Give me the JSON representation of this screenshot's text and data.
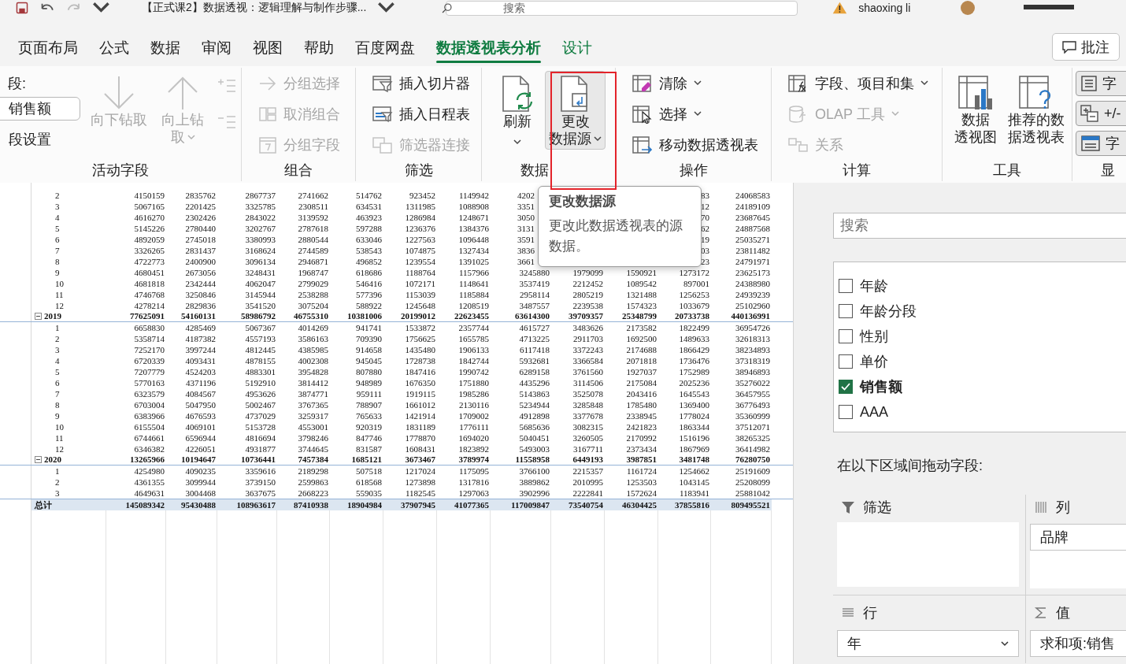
{
  "title_bar": {
    "document_title": "【正式课2】数据透视：逻辑理解与制作步骤...",
    "search_placeholder": "搜索",
    "user_name": "shaoxing li"
  },
  "ribbon_tabs": [
    {
      "label": "页面布局",
      "selected": false,
      "contextual": false
    },
    {
      "label": "公式",
      "selected": false,
      "contextual": false
    },
    {
      "label": "数据",
      "selected": false,
      "contextual": false
    },
    {
      "label": "审阅",
      "selected": false,
      "contextual": false
    },
    {
      "label": "视图",
      "selected": false,
      "contextual": false
    },
    {
      "label": "帮助",
      "selected": false,
      "contextual": false
    },
    {
      "label": "百度网盘",
      "selected": false,
      "contextual": false
    },
    {
      "label": "数据透视表分析",
      "selected": true,
      "contextual": true
    },
    {
      "label": "设计",
      "selected": false,
      "contextual": true
    }
  ],
  "comment_button": "批注",
  "ribbon_groups": [
    {
      "label": "活动字段",
      "columns": [
        [
          {
            "kind": "label",
            "text": "段:"
          },
          {
            "kind": "field",
            "value": "销售额"
          },
          {
            "kind": "text",
            "text": "段设置"
          }
        ],
        [
          {
            "kind": "large",
            "lines": [
              "向下钻取"
            ],
            "disabled": true,
            "hovered": false
          }
        ],
        [
          {
            "kind": "large",
            "lines": [
              "向上钻",
              "取"
            ],
            "disabled": true,
            "hovered": false,
            "dropdown": true
          }
        ],
        [
          {
            "kind": "icon",
            "disabled": true,
            "hovered": false
          },
          {
            "kind": "icon",
            "disabled": true,
            "hovered": false
          }
        ]
      ]
    },
    {
      "label": "组合",
      "columns": [
        [
          {
            "kind": "small",
            "text": "分组选择",
            "disabled": true,
            "hovered": false
          },
          {
            "kind": "small",
            "text": "取消组合",
            "disabled": true,
            "hovered": false
          },
          {
            "kind": "small",
            "text": "分组字段",
            "disabled": true,
            "hovered": false
          }
        ]
      ]
    },
    {
      "label": "筛选",
      "columns": [
        [
          {
            "kind": "small",
            "text": "插入切片器",
            "disabled": false,
            "hovered": false
          },
          {
            "kind": "small",
            "text": "插入日程表",
            "disabled": false,
            "hovered": false
          },
          {
            "kind": "small",
            "text": "筛选器连接",
            "disabled": true,
            "hovered": false
          }
        ]
      ]
    },
    {
      "label": "数据",
      "columns": [
        [
          {
            "kind": "large",
            "lines": [
              "刷新"
            ],
            "disabled": false,
            "hovered": false,
            "dropdown": true
          }
        ],
        [
          {
            "kind": "large",
            "lines": [
              "更改",
              "数据源"
            ],
            "disabled": false,
            "hovered": true,
            "dropdown": true
          }
        ]
      ]
    },
    {
      "label": "操作",
      "columns": [
        [
          {
            "kind": "small",
            "text": "清除",
            "disabled": false,
            "hovered": false,
            "dropdown": true
          },
          {
            "kind": "small",
            "text": "选择",
            "disabled": false,
            "hovered": false,
            "dropdown": true
          },
          {
            "kind": "small",
            "text": "移动数据透视表",
            "disabled": false,
            "hovered": false
          }
        ]
      ]
    },
    {
      "label": "计算",
      "columns": [
        [
          {
            "kind": "small",
            "text": "字段、项目和集",
            "disabled": false,
            "hovered": false,
            "dropdown": true
          },
          {
            "kind": "small",
            "text": "OLAP 工具",
            "disabled": true,
            "hovered": false,
            "dropdown": true
          },
          {
            "kind": "small",
            "text": "关系",
            "disabled": true,
            "hovered": false
          }
        ]
      ]
    },
    {
      "label": "工具",
      "columns": [
        [
          {
            "kind": "large",
            "lines": [
              "数据",
              "透视图"
            ],
            "disabled": false,
            "hovered": false
          }
        ],
        [
          {
            "kind": "large",
            "lines": [
              "推荐的数",
              "据透视表"
            ],
            "disabled": false,
            "hovered": false
          }
        ]
      ]
    },
    {
      "label": "显",
      "columns": [
        [
          {
            "kind": "toggle",
            "text": "字",
            "on": true
          },
          {
            "kind": "toggle",
            "text": "+/-",
            "on": true
          },
          {
            "kind": "toggle",
            "text": "字",
            "on": true
          }
        ]
      ]
    }
  ],
  "tooltip": {
    "title": "更改数据源",
    "text": "更改此数据透视表的源数据。"
  },
  "pivot_table": {
    "rows": [
      {
        "kind": "month",
        "label": "2",
        "cells": [
          "4150159",
          "2835762",
          "2867737",
          "2741662",
          "514762",
          "923452",
          "1149942",
          {
            "text": "4202",
            "cut": true
          },
          null,
          null,
          "83",
          "24068583"
        ]
      },
      {
        "kind": "month",
        "label": "3",
        "cells": [
          "5067165",
          "2201425",
          "3325785",
          "2308511",
          "634531",
          "1311985",
          "1088908",
          {
            "text": "3351",
            "cut": true
          },
          null,
          null,
          "12",
          "24189109"
        ]
      },
      {
        "kind": "month",
        "label": "4",
        "cells": [
          "4616270",
          "2302426",
          "2843022",
          "3139592",
          "463923",
          "1286984",
          "1248671",
          {
            "text": "3050",
            "cut": true
          },
          null,
          null,
          "70",
          "23687645"
        ]
      },
      {
        "kind": "month",
        "label": "5",
        "cells": [
          "5145226",
          "2780440",
          "3202767",
          "2787618",
          "597288",
          "1236376",
          "1384376",
          {
            "text": "3131",
            "cut": true
          },
          null,
          null,
          "62",
          "24887568"
        ]
      },
      {
        "kind": "month",
        "label": "6",
        "cells": [
          "4892059",
          "2745018",
          "3380993",
          "2880544",
          "633046",
          "1227563",
          "1096448",
          {
            "text": "3591",
            "cut": true
          },
          null,
          null,
          "19",
          "25035271"
        ]
      },
      {
        "kind": "month",
        "label": "7",
        "cells": [
          "3326265",
          "2831437",
          "3168624",
          "2744589",
          "538543",
          "1074875",
          "1327434",
          {
            "text": "3836",
            "cut": true
          },
          null,
          null,
          "03",
          "23811482"
        ]
      },
      {
        "kind": "month",
        "label": "8",
        "cells": [
          "4722773",
          "2400900",
          "3096134",
          "2946871",
          "496852",
          "1239554",
          "1391025",
          {
            "text": "3661",
            "cut": true
          },
          null,
          null,
          "23",
          "24791971"
        ]
      },
      {
        "kind": "month",
        "label": "9",
        "cells": [
          "4680451",
          "2673056",
          "3248431",
          "1968747",
          "618686",
          "1188764",
          "1157966",
          "3245880",
          "1979099",
          "1590921",
          "1273172",
          "23625173"
        ]
      },
      {
        "kind": "month",
        "label": "10",
        "cells": [
          "4681818",
          "2342444",
          "4062047",
          "2799029",
          "546416",
          "1072171",
          "1148641",
          "3537419",
          "2212452",
          "1089542",
          "897001",
          "24388980"
        ]
      },
      {
        "kind": "month",
        "label": "11",
        "cells": [
          "4746768",
          "3250846",
          "3145944",
          "2538288",
          "577396",
          "1153039",
          "1185884",
          "2958114",
          "2805219",
          "1321488",
          "1256253",
          "24939239"
        ]
      },
      {
        "kind": "month",
        "label": "12",
        "cells": [
          "4278214",
          "2829836",
          "3541520",
          "3075204",
          "588922",
          "1245648",
          "1208519",
          "3487557",
          "2239538",
          "1574323",
          "1033679",
          "25102960"
        ]
      },
      {
        "kind": "year",
        "label": "2019",
        "expanded": true,
        "cells": [
          "77625091",
          "54160131",
          "58986792",
          "46755310",
          "10381006",
          "20199012",
          "22623455",
          "63614300",
          "39709357",
          "25348799",
          "20733738",
          "440136991"
        ]
      },
      {
        "kind": "month",
        "label": "1",
        "cells": [
          "6658830",
          "4285469",
          "5067367",
          "4014269",
          "941741",
          "1533872",
          "2357744",
          "4615727",
          "3483626",
          "2173582",
          "1822499",
          "36954726"
        ]
      },
      {
        "kind": "month",
        "label": "2",
        "cells": [
          "5358714",
          "4187382",
          "4557193",
          "3586163",
          "709390",
          "1756625",
          "1655785",
          "4713225",
          "2911703",
          "1692500",
          "1489633",
          "32618313"
        ]
      },
      {
        "kind": "month",
        "label": "3",
        "cells": [
          "7252170",
          "3997244",
          "4812445",
          "4385985",
          "914658",
          "1435480",
          "1906133",
          "6117418",
          "3372243",
          "2174688",
          "1866429",
          "38234893"
        ]
      },
      {
        "kind": "month",
        "label": "4",
        "cells": [
          "6720339",
          "4093431",
          "4878155",
          "4002308",
          "945045",
          "1728738",
          "1842744",
          "5932681",
          "3366584",
          "2071818",
          "1736476",
          "37318319"
        ]
      },
      {
        "kind": "month",
        "label": "5",
        "cells": [
          "7207779",
          "4524203",
          "4883301",
          "3954828",
          "807880",
          "1847416",
          "1990742",
          "6289158",
          "3761560",
          "1927037",
          "1752989",
          "38946893"
        ]
      },
      {
        "kind": "month",
        "label": "6",
        "cells": [
          "5770163",
          "4371196",
          "5192910",
          "3814412",
          "948989",
          "1676350",
          "1751880",
          "4435296",
          "3114506",
          "2175084",
          "2025236",
          "35276022"
        ]
      },
      {
        "kind": "month",
        "label": "7",
        "cells": [
          "6323579",
          "4084567",
          "4953626",
          "3874771",
          "959111",
          "1919115",
          "1985286",
          "5143863",
          "3525078",
          "2043416",
          "1645543",
          "36457955"
        ]
      },
      {
        "kind": "month",
        "label": "8",
        "cells": [
          "6703004",
          "5047950",
          "5002467",
          "3767365",
          "788907",
          "1661012",
          "2130116",
          "5234944",
          "3285848",
          "1785480",
          "1369400",
          "36776493"
        ]
      },
      {
        "kind": "month",
        "label": "9",
        "cells": [
          "6383966",
          "4676593",
          "4737029",
          "3259317",
          "765633",
          "1421914",
          "1709002",
          "4912898",
          "3377678",
          "2338945",
          "1778024",
          "35360999"
        ]
      },
      {
        "kind": "month",
        "label": "10",
        "cells": [
          "6155504",
          "4069101",
          "5153728",
          "4553001",
          "920319",
          "1831189",
          "1776111",
          "5685636",
          "3082315",
          "2421823",
          "1863344",
          "37512071"
        ]
      },
      {
        "kind": "month",
        "label": "11",
        "cells": [
          "6744661",
          "6596944",
          "4816694",
          "3798246",
          "847746",
          "1778870",
          "1694020",
          "5040451",
          "3260505",
          "2170992",
          "1516196",
          "38265325"
        ]
      },
      {
        "kind": "month",
        "label": "12",
        "cells": [
          "6346382",
          "4226051",
          "4931877",
          "3744645",
          "831587",
          "1608431",
          "1823892",
          "5493003",
          "3167711",
          "2373434",
          "1867969",
          "36414982"
        ]
      },
      {
        "kind": "year",
        "label": "2020",
        "expanded": true,
        "cells": [
          "13265966",
          "10194647",
          "10736441",
          "7457384",
          "1685121",
          "3673467",
          "3789974",
          "11558958",
          "6449193",
          "3987851",
          "3481748",
          "76280750"
        ]
      },
      {
        "kind": "month",
        "label": "1",
        "cells": [
          "4254980",
          "4090235",
          "3359616",
          "2189298",
          "507518",
          "1217024",
          "1175095",
          "3766100",
          "2215357",
          "1161724",
          "1254662",
          "25191609"
        ]
      },
      {
        "kind": "month",
        "label": "2",
        "cells": [
          "4361355",
          "3099944",
          "3739150",
          "2599863",
          "618568",
          "1273898",
          "1317816",
          "3889862",
          "2010995",
          "1253503",
          "1043145",
          "25208099"
        ]
      },
      {
        "kind": "month",
        "label": "3",
        "cells": [
          "4649631",
          "3004468",
          "3637675",
          "2668223",
          "559035",
          "1182545",
          "1297063",
          "3902996",
          "2222841",
          "1572624",
          "1183941",
          "25881042"
        ]
      },
      {
        "kind": "total",
        "label": "总计",
        "cells": [
          "145089342",
          "95430488",
          "108963617",
          "87410938",
          "18904984",
          "37907945",
          "41077365",
          "117009847",
          "73540754",
          "46304425",
          "37855816",
          "809495521"
        ]
      }
    ]
  },
  "field_pane": {
    "search_placeholder": "搜索",
    "fields": [
      {
        "label": "年龄",
        "checked": false
      },
      {
        "label": "年龄分段",
        "checked": false
      },
      {
        "label": "性别",
        "checked": false
      },
      {
        "label": "单价",
        "checked": false
      },
      {
        "label": "销售额",
        "checked": true
      },
      {
        "label": "AAA",
        "checked": false
      }
    ],
    "areas_hint": "在以下区域间拖动字段:",
    "areas": [
      {
        "kind": "filter",
        "label": "筛选"
      },
      {
        "kind": "columns",
        "label": "列",
        "items": [
          {
            "text": "品牌",
            "dropdown": false
          }
        ]
      },
      {
        "kind": "rows",
        "label": "行",
        "items": [
          {
            "text": "年",
            "dropdown": true
          }
        ]
      },
      {
        "kind": "values",
        "label": "值",
        "items": [
          {
            "text": "求和项:销售",
            "dropdown": false
          }
        ]
      }
    ]
  }
}
